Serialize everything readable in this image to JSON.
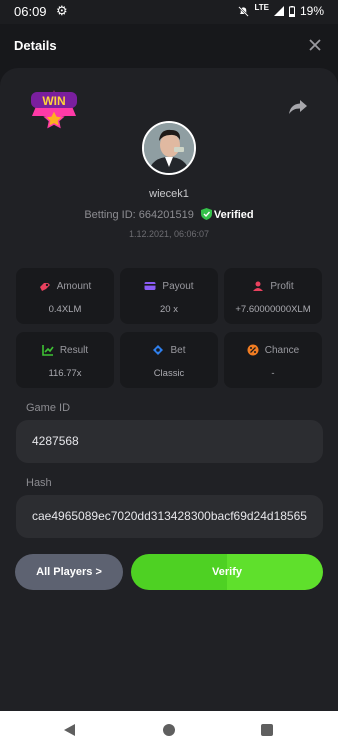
{
  "status_bar": {
    "time": "06:09",
    "network": "LTE",
    "battery": "19%"
  },
  "header": {
    "title": "Details"
  },
  "badge": {
    "text": "WIN"
  },
  "profile": {
    "username": "wiecek1",
    "betting_id_label": "Betting ID:",
    "betting_id": "664201519",
    "verified_label": "Verified",
    "date": "1.12.2021, 06:06:07"
  },
  "stats": [
    {
      "label": "Amount",
      "value": "0.4XLM",
      "icon": "amount-icon",
      "color": "#e8415e"
    },
    {
      "label": "Payout",
      "value": "20 x",
      "icon": "payout-card-icon",
      "color": "#8b5cf6"
    },
    {
      "label": "Profit",
      "value": "+7.60000000XLM",
      "icon": "profit-icon",
      "color": "#e8415e"
    },
    {
      "label": "Result",
      "value": "116.77x",
      "icon": "result-chart-icon",
      "color": "#3ec234"
    },
    {
      "label": "Bet",
      "value": "Classic",
      "icon": "bet-icon",
      "color": "#2f80ed"
    },
    {
      "label": "Chance",
      "value": "-",
      "icon": "chance-icon",
      "color": "#f07c22"
    }
  ],
  "game_id": {
    "label": "Game ID",
    "value": "4287568"
  },
  "hash": {
    "label": "Hash",
    "value": "cae4965089ec7020dd313428300bacf69d24d18565"
  },
  "buttons": {
    "all_players": "All Players >",
    "verify": "Verify"
  },
  "colors": {
    "background": "#17181b",
    "card": "#202125",
    "verify_green": "#4ed123",
    "players_gray": "#5d6271"
  }
}
